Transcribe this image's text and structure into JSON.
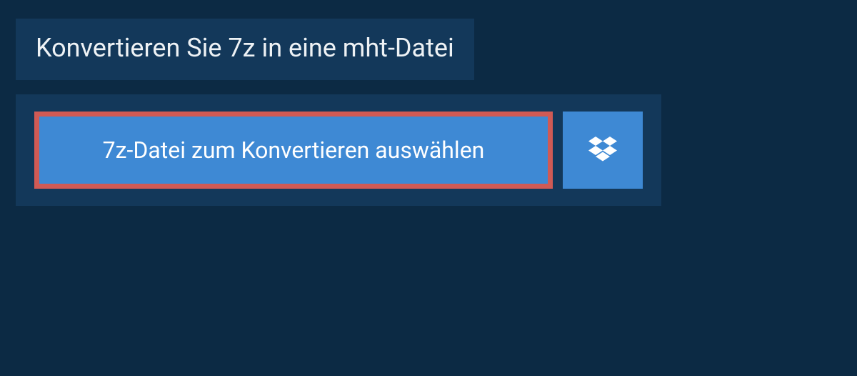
{
  "title": "Konvertieren Sie 7z in eine mht-Datei",
  "actions": {
    "select_file_label": "7z-Datei zum Konvertieren auswählen"
  }
}
